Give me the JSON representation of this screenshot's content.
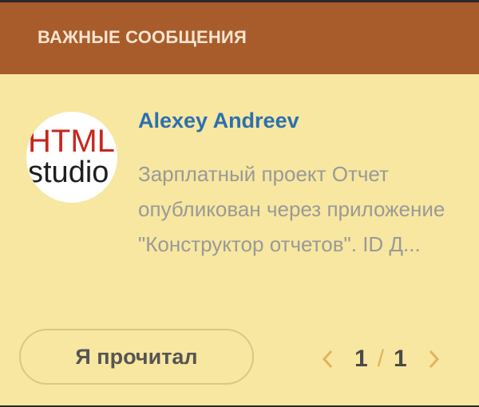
{
  "header": {
    "title": "ВАЖНЫЕ СООБЩЕНИЯ"
  },
  "avatar": {
    "logo_line1": "HTML",
    "logo_line2": "studio"
  },
  "message": {
    "author": "Alexey Andreev",
    "text": "Зарплатный проект Отчет опубликован через приложение \"Конструктор отчетов\". ID Д..."
  },
  "actions": {
    "read_label": "Я прочитал"
  },
  "pager": {
    "current": "1",
    "separator": "/",
    "total": "1"
  },
  "colors": {
    "header_bg": "#a85c2c",
    "panel_bg": "#f7e7a0",
    "author": "#2d6fb0",
    "pager_arrow": "#e0b45c"
  },
  "icons": {
    "prev": "chevron-left-icon",
    "next": "chevron-right-icon"
  }
}
